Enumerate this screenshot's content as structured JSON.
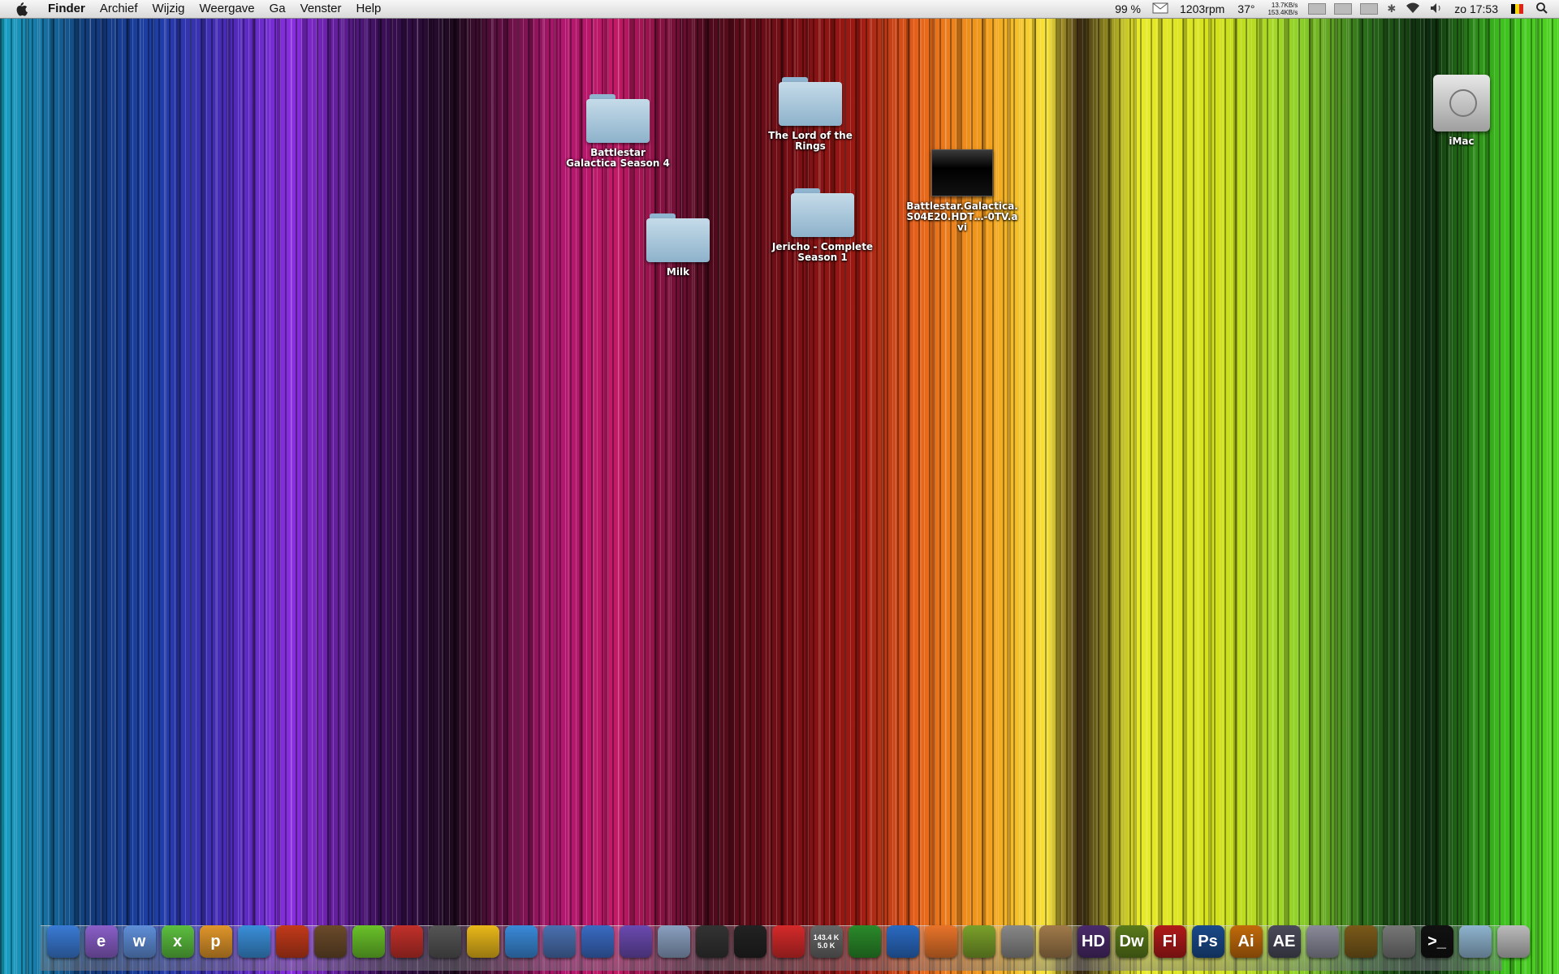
{
  "menubar": {
    "app_name": "Finder",
    "menus": [
      "Archief",
      "Wijzig",
      "Weergave",
      "Ga",
      "Venster",
      "Help"
    ],
    "status": {
      "battery": "99 %",
      "fan_speed": "1203rpm",
      "temperature": "37°",
      "net_up": "13.7KB/s",
      "net_down": "153.4KB/s",
      "clock": "zo 17:53"
    }
  },
  "desktop": {
    "icons": [
      {
        "label": "Battlestar Galactica Season 4",
        "kind": "folder"
      },
      {
        "label": "The Lord of the Rings",
        "kind": "folder"
      },
      {
        "label": "Milk",
        "kind": "folder"
      },
      {
        "label": "Jericho - Complete Season 1",
        "kind": "folder"
      },
      {
        "label": "Battlestar.Galactica.S04E20.HDT…-0TV.avi",
        "kind": "video"
      },
      {
        "label": "iMac",
        "kind": "hard-drive"
      }
    ]
  },
  "dock": {
    "items": [
      {
        "name": "finder",
        "label": "",
        "color": "#3a7bd5"
      },
      {
        "name": "entourage",
        "label": "e",
        "color": "#8a5fc9"
      },
      {
        "name": "word",
        "label": "w",
        "color": "#5f8fd9"
      },
      {
        "name": "excel",
        "label": "x",
        "color": "#5cbf3f"
      },
      {
        "name": "powerpoint",
        "label": "p",
        "color": "#e0962a"
      },
      {
        "name": "messenger",
        "label": "",
        "color": "#3a8fd9"
      },
      {
        "name": "flash-tool",
        "label": "",
        "color": "#c23a1a"
      },
      {
        "name": "iphoto",
        "label": "",
        "color": "#6a4a2a"
      },
      {
        "name": "iwork",
        "label": "",
        "color": "#6ac22a"
      },
      {
        "name": "parallels",
        "label": "",
        "color": "#c2302a"
      },
      {
        "name": "growl",
        "label": "",
        "color": "#555"
      },
      {
        "name": "adium",
        "label": "",
        "color": "#e9b81a"
      },
      {
        "name": "itunes",
        "label": "",
        "color": "#3a8ad9"
      },
      {
        "name": "mail",
        "label": "",
        "color": "#4a70b0"
      },
      {
        "name": "safari",
        "label": "",
        "color": "#3a6ac2"
      },
      {
        "name": "wizard",
        "label": "",
        "color": "#6a4ab0"
      },
      {
        "name": "disk-tool",
        "label": "",
        "color": "#8aa0c0"
      },
      {
        "name": "camino",
        "label": "",
        "color": "#333"
      },
      {
        "name": "imovie",
        "label": "",
        "color": "#222"
      },
      {
        "name": "lastfm",
        "label": "",
        "color": "#d52a2a"
      },
      {
        "name": "transmission",
        "label": "143.4 K 5.0 K",
        "color": "#666"
      },
      {
        "name": "jamaica",
        "label": "",
        "color": "#2a8a2a"
      },
      {
        "name": "quicktime",
        "label": "",
        "color": "#2a6ac2"
      },
      {
        "name": "vlc",
        "label": "",
        "color": "#e8742a"
      },
      {
        "name": "hammer",
        "label": "",
        "color": "#7aa02a"
      },
      {
        "name": "dvd-player",
        "label": "",
        "color": "#888"
      },
      {
        "name": "archive",
        "label": "",
        "color": "#a07a4a"
      },
      {
        "name": "hd-app",
        "label": "HD",
        "color": "#4a2a6a"
      },
      {
        "name": "dreamweaver",
        "label": "Dw",
        "color": "#5a7a1a"
      },
      {
        "name": "flash",
        "label": "Fl",
        "color": "#b01a1a"
      },
      {
        "name": "photoshop",
        "label": "Ps",
        "color": "#1a4a8a"
      },
      {
        "name": "illustrator",
        "label": "Ai",
        "color": "#c26a0a"
      },
      {
        "name": "after-effects",
        "label": "AE",
        "color": "#4a4a5a"
      },
      {
        "name": "preview",
        "label": "",
        "color": "#8a8a9a"
      },
      {
        "name": "time-machine",
        "label": "",
        "color": "#7a5a1a"
      },
      {
        "name": "system-preferences",
        "label": "",
        "color": "#777"
      },
      {
        "name": "terminal",
        "label": ">_",
        "color": "#111"
      },
      {
        "name": "documents-folder",
        "label": "",
        "color": "#8fb4cf"
      },
      {
        "name": "trash",
        "label": "",
        "color": "#bbb"
      }
    ]
  }
}
